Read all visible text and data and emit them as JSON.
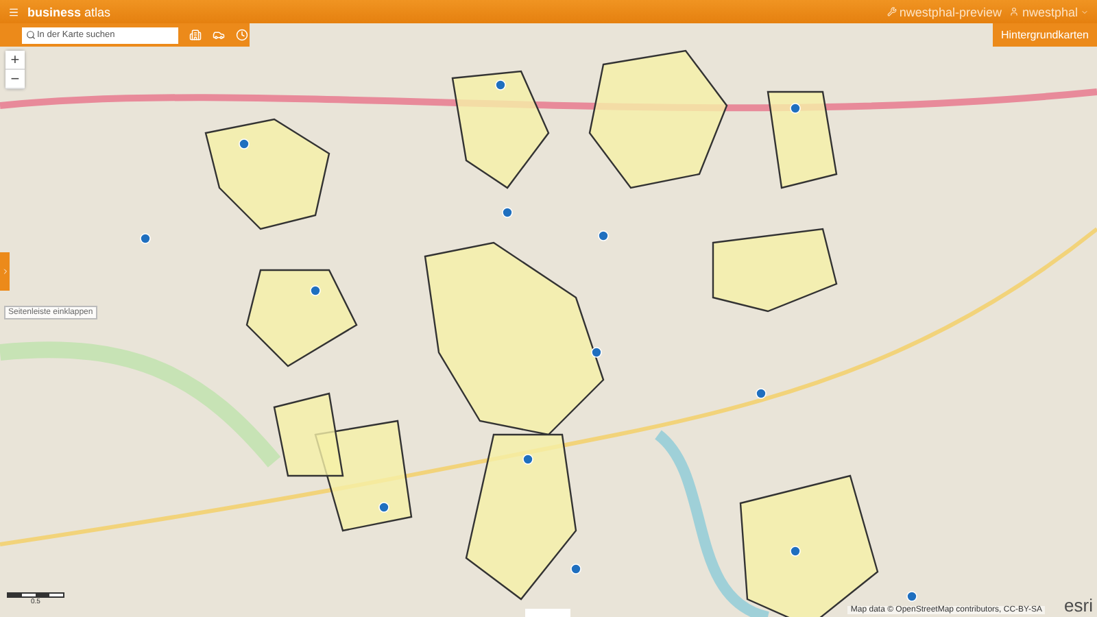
{
  "header": {
    "title": "**business** atlas",
    "project": "nwestphal-preview",
    "user": "nwestphal"
  },
  "search": {
    "placeholder": "In der Karte suchen"
  },
  "zoom": {
    "in": "+",
    "out": "−"
  },
  "basemap_button": "Hintergrundkarten",
  "sidebar_tooltip": "Seitenleiste einklappen",
  "scale": {
    "label": "0.5"
  },
  "attribution": "Map data © OpenStreetMap contributors, CC-BY-SA",
  "logo": "esri"
}
